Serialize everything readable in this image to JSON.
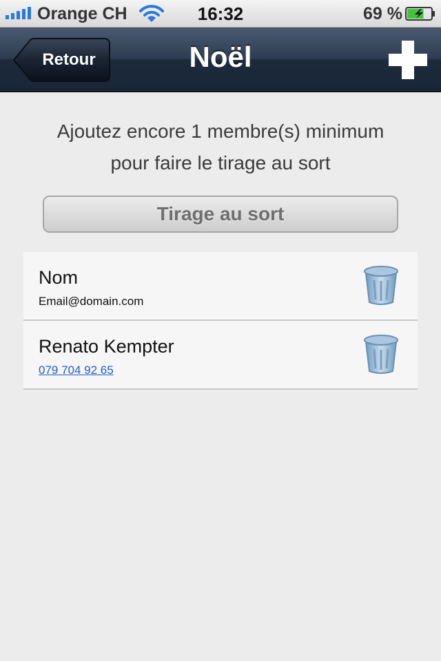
{
  "status_bar": {
    "carrier": "Orange CH",
    "time": "16:32",
    "battery": "69 %",
    "battery_level": 0.69,
    "signal_icon": "signal-bars-icon",
    "wifi_icon": "wifi-icon",
    "battery_icon": "battery-charging-icon"
  },
  "nav": {
    "back_label": "Retour",
    "title": "Noël",
    "add_icon": "plus-icon"
  },
  "content": {
    "hint_line1": "Ajoutez encore 1 membre(s) minimum",
    "hint_line2": "pour faire le tirage au sort",
    "draw_button": "Tirage au sort"
  },
  "members": [
    {
      "name": "Nom",
      "detail": "Email@domain.com",
      "detail_is_link": false,
      "delete_icon": "trash-icon"
    },
    {
      "name": "Renato Kempter",
      "detail": "079 704 92 65",
      "detail_is_link": true,
      "delete_icon": "trash-icon"
    }
  ],
  "colors": {
    "nav_bar": "#2e3d52",
    "link": "#1f5fcc",
    "background": "#ececec",
    "battery_fill": "#3fc53a"
  }
}
